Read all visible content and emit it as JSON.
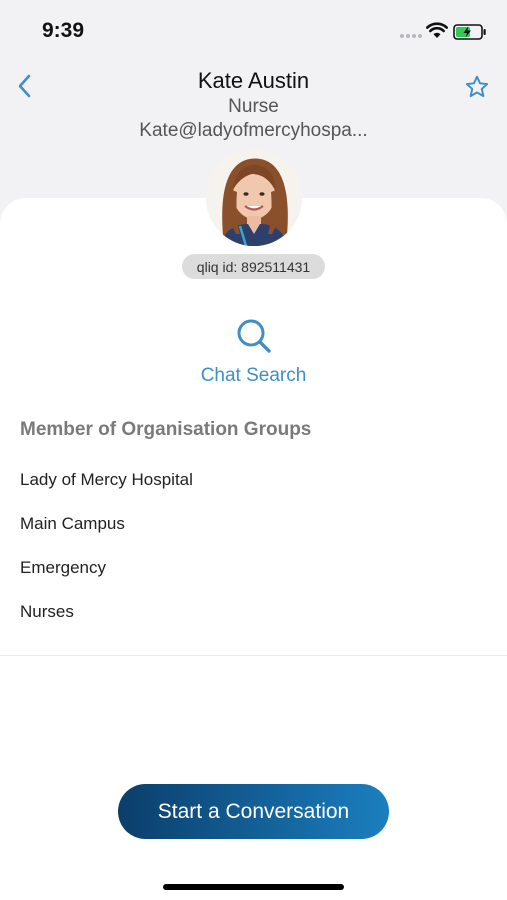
{
  "status": {
    "time": "9:39"
  },
  "header": {
    "name": "Kate Austin",
    "role": "Nurse",
    "email": "Kate@ladyofmercyhospa..."
  },
  "profile": {
    "qliq_id": "qliq id: 892511431"
  },
  "chat_search": {
    "label": "Chat Search"
  },
  "groups": {
    "title": "Member of Organisation Groups",
    "items": [
      "Lady of Mercy Hospital",
      "Main Campus",
      "Emergency",
      "Nurses"
    ]
  },
  "actions": {
    "start_conversation": "Start a Conversation"
  },
  "colors": {
    "accent": "#3e8fc8",
    "cta_start": "#0b3e6b",
    "cta_end": "#1b7fbf"
  }
}
